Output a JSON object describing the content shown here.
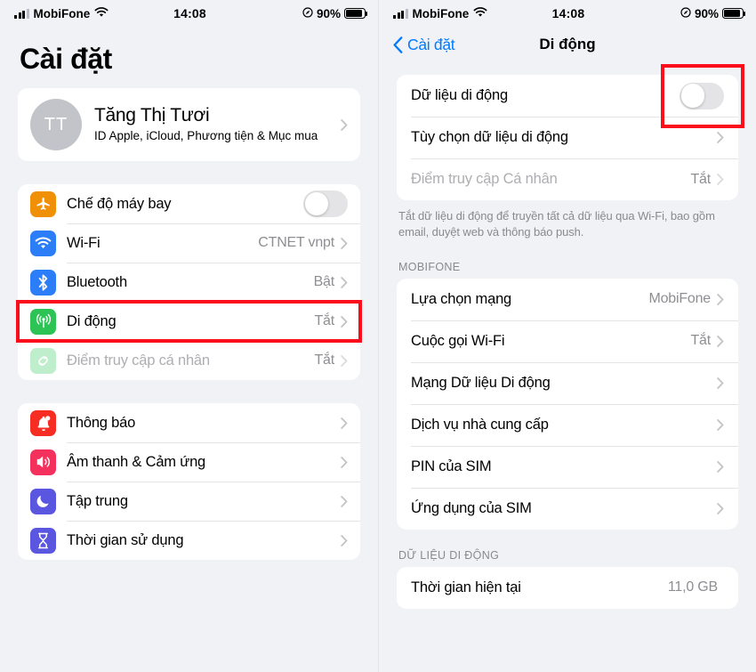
{
  "status_bar": {
    "carrier": "MobiFone",
    "time": "14:08",
    "battery_percent": "90%",
    "wifi_icon": "wifi-icon",
    "signal_icon": "signal-bars-icon",
    "battery_icon": "battery-icon",
    "location_icon": "location-services-icon"
  },
  "left_screen": {
    "title": "Cài đặt",
    "account": {
      "initials": "TT",
      "name": "Tăng Thị Tươi",
      "subtitle": "ID Apple, iCloud, Phương tiện & Mục mua"
    },
    "group_connectivity": [
      {
        "label": "Chế độ máy bay",
        "icon": "airplane-icon",
        "icon_color": "#f09007",
        "control": "toggle",
        "toggle_on": false
      },
      {
        "label": "Wi-Fi",
        "icon": "wifi-icon",
        "icon_color": "#2b7ef8",
        "value": "CTNET vnpt",
        "control": "chevron"
      },
      {
        "label": "Bluetooth",
        "icon": "bluetooth-icon",
        "icon_color": "#2b7ef8",
        "value": "Bật",
        "control": "chevron"
      },
      {
        "label": "Di động",
        "icon": "cellular-icon",
        "icon_color": "#2ec455",
        "value": "Tắt",
        "control": "chevron",
        "highlighted": true
      },
      {
        "label": "Điểm truy cập cá nhân",
        "icon": "personal-hotspot-icon",
        "icon_color": "#8be0a2",
        "value": "Tắt",
        "control": "chevron",
        "disabled": true
      }
    ],
    "group_system": [
      {
        "label": "Thông báo",
        "icon": "bell-icon",
        "icon_color": "#f72c22",
        "control": "chevron"
      },
      {
        "label": "Âm thanh & Cảm ứng",
        "icon": "speaker-icon",
        "icon_color": "#f4315c",
        "control": "chevron"
      },
      {
        "label": "Tập trung",
        "icon": "moon-icon",
        "icon_color": "#5a56e0",
        "control": "chevron"
      },
      {
        "label": "Thời gian sử dụng",
        "icon": "hourglass-icon",
        "icon_color": "#5a56e0",
        "control": "chevron"
      }
    ]
  },
  "right_screen": {
    "back_label": "Cài đặt",
    "title": "Di động",
    "group_top": [
      {
        "label": "Dữ liệu di động",
        "control": "toggle",
        "toggle_on": false,
        "highlighted": true
      },
      {
        "label": "Tùy chọn dữ liệu di động",
        "control": "chevron"
      },
      {
        "label": "Điểm truy cập Cá nhân",
        "value": "Tắt",
        "control": "chevron",
        "disabled": true
      }
    ],
    "footnote": "Tắt dữ liệu di động để truyền tất cả dữ liệu qua Wi-Fi, bao gồm email, duyệt web và thông báo push.",
    "carrier_section_header": "MOBIFONE",
    "group_carrier": [
      {
        "label": "Lựa chọn mạng",
        "value": "MobiFone",
        "control": "chevron"
      },
      {
        "label": "Cuộc gọi Wi-Fi",
        "value": "Tắt",
        "control": "chevron"
      },
      {
        "label": "Mạng Dữ liệu Di động",
        "control": "chevron"
      },
      {
        "label": "Dịch vụ nhà cung cấp",
        "control": "chevron"
      },
      {
        "label": "PIN của SIM",
        "control": "chevron"
      },
      {
        "label": "Ứng dụng của SIM",
        "control": "chevron"
      }
    ],
    "data_section_header": "DỮ LIỆU DI ĐỘNG",
    "group_data": [
      {
        "label": "Thời gian hiện tại",
        "value": "11,0 GB"
      }
    ]
  },
  "annotations": {
    "highlight_color": "#fc0d1b"
  }
}
